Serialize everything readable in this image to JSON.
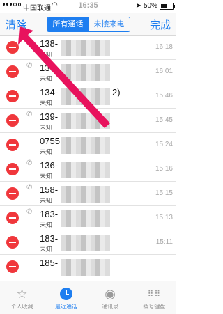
{
  "status": {
    "carrier": "中国联通",
    "time": "16:35",
    "battery": "50%"
  },
  "nav": {
    "clear_label": "清除",
    "done_label": "完成",
    "seg_all": "所有通话",
    "seg_missed": "未接来电"
  },
  "calls": [
    {
      "number": "138-",
      "label": "未知",
      "time": "16:18",
      "phone_icon": false
    },
    {
      "number": "136-",
      "label": "未知",
      "time": "16:01",
      "phone_icon": true
    },
    {
      "number": "134-",
      "label": "未知",
      "time": "15:46",
      "phone_icon": false,
      "suffix": "2)"
    },
    {
      "number": "139-",
      "label": "未知",
      "time": "15:45",
      "phone_icon": true
    },
    {
      "number": "0755",
      "label": "未知",
      "time": "15:24",
      "phone_icon": false
    },
    {
      "number": "136-",
      "label": "未知",
      "time": "15:16",
      "phone_icon": true
    },
    {
      "number": "158-",
      "label": "未知",
      "time": "15:15",
      "phone_icon": true
    },
    {
      "number": "183-",
      "label": "未知",
      "time": "15:13",
      "phone_icon": true
    },
    {
      "number": "183-",
      "label": "未知",
      "time": "15:11",
      "phone_icon": false
    },
    {
      "number": "185-",
      "label": "",
      "time": "",
      "phone_icon": false
    }
  ],
  "tabs": [
    {
      "label": "个人收藏",
      "icon": "star-icon"
    },
    {
      "label": "最近通话",
      "icon": "clock-icon",
      "active": true
    },
    {
      "label": "通讯录",
      "icon": "contacts-icon"
    },
    {
      "label": "拨号键盘",
      "icon": "keypad-icon"
    }
  ],
  "colors": {
    "accent": "#1e7ef0",
    "delete": "#f0373c",
    "arrow": "#e8125d"
  }
}
